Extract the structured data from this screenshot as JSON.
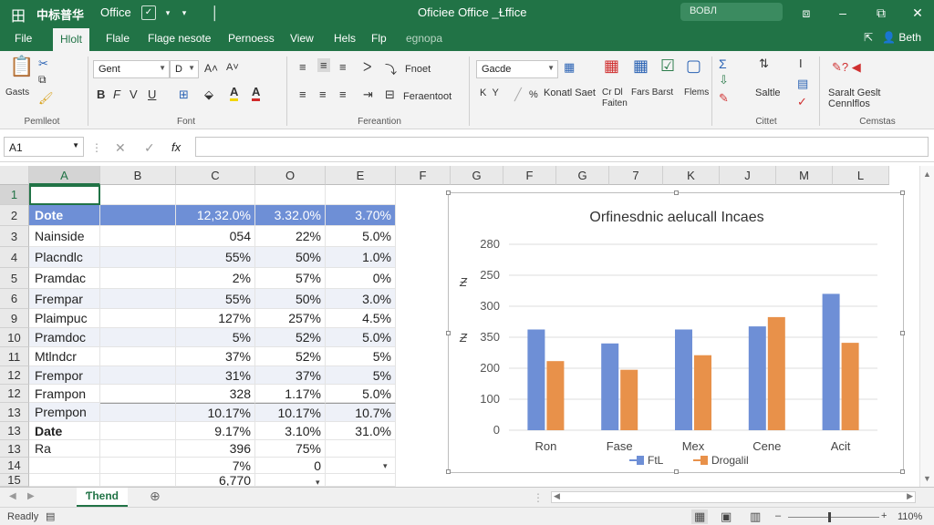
{
  "titlebar": {
    "app_glyph": "田",
    "app_name": "中标普华",
    "office_label": "Office",
    "doc_title": "Oficiee Office _Ɫffice",
    "search_text": "ВОВЛ"
  },
  "ribbon_tabs": [
    "File",
    "Hlolt",
    "Flale",
    "Flage nesote",
    "Pernoess",
    "View",
    "Hels",
    "Flp",
    "egnopa"
  ],
  "user_name": "Beth",
  "ribbon": {
    "clipboard": {
      "paste_label": "Gasts",
      "group_label": "Pemlleot"
    },
    "font": {
      "font_name": "Gent",
      "font_size": "D",
      "bold": "B",
      "italic": "F",
      "underline": "V",
      "U": "U",
      "group_label": "Font"
    },
    "alignment": {
      "wrap_label": "Fnoet",
      "merge_label": "Feraentoot",
      "group_label": "Fereantion"
    },
    "number": {
      "format": "Gacde",
      "styles_label": "Konatl Saet",
      "group_label": ""
    },
    "styles": {
      "cond_label": "Cr Dl",
      "cond_label2": "Faiten",
      "fmt_label": "Fars Barst",
      "cell_label": "Flems"
    },
    "cells": {
      "sort_label": "Saltle",
      "group_label": "Cittet"
    },
    "editing": {
      "label1": "Saralt Geslt",
      "label2": "Cennlflos",
      "group_label": "Cemstas"
    }
  },
  "formula_bar": {
    "name_box": "A1",
    "fx": "fx",
    "formula": ""
  },
  "columns": [
    "A",
    "B",
    "C",
    "O",
    "E",
    "F",
    "G",
    "F",
    "G",
    "7",
    "K",
    "J",
    "M",
    "L"
  ],
  "rows": [
    {
      "num": "1",
      "a": "",
      "c": "",
      "d": "",
      "e": ""
    },
    {
      "num": "2",
      "a": "Dote",
      "c": "12,32.0%",
      "d": "3.32.0%",
      "e": "3.70%"
    },
    {
      "num": "3",
      "a": "Nainside",
      "c": "054",
      "d": "22%",
      "e": "5.0%"
    },
    {
      "num": "4",
      "a": "Placndlc",
      "c": "55%",
      "d": "50%",
      "e": "1.0%"
    },
    {
      "num": "5",
      "a": "Pramdac",
      "c": "2%",
      "d": "57%",
      "e": "0%"
    },
    {
      "num": "6",
      "a": "Frempar",
      "c": "55%",
      "d": "50%",
      "e": "3.0%"
    },
    {
      "num": "9",
      "a": "Plaimpuc",
      "c": "127%",
      "d": "257%",
      "e": "4.5%"
    },
    {
      "num": "10",
      "a": "Pramdoc",
      "c": "5%",
      "d": "52%",
      "e": "5.0%"
    },
    {
      "num": "11",
      "a": "Mtlndcr",
      "c": "37%",
      "d": "52%",
      "e": "5%"
    },
    {
      "num": "12",
      "a": "Frempor",
      "c": "31%",
      "d": "37%",
      "e": "5%"
    },
    {
      "num": "12",
      "a": "Frampon",
      "c": "328",
      "d": "1.17%",
      "e": "5.0%"
    },
    {
      "num": "13",
      "a": "Prempon",
      "c": "10.17%",
      "d": "10.17%",
      "e": "10.7%"
    },
    {
      "num": "13",
      "a": "Date",
      "c": "9.17%",
      "d": "3.10%",
      "e": "31.0%"
    },
    {
      "num": "13",
      "a": "Ra",
      "c": "396",
      "d": "75%",
      "e": ""
    },
    {
      "num": "14",
      "a": "",
      "c": "7%",
      "d": "0",
      "e": ""
    },
    {
      "num": "15",
      "a": "",
      "c": "6,770",
      "d": "",
      "e": ""
    }
  ],
  "sheet_tab": "Ƭhend",
  "status": {
    "ready": "Readly",
    "zoom": "110%"
  },
  "chart_data": {
    "type": "bar",
    "title": "Orfinesdnic aelucall Incaes",
    "categories": [
      "Ron",
      "Fase",
      "Mex",
      "Cene",
      "Acit"
    ],
    "series": [
      {
        "name": "FtL",
        "color": "#6e8fd6",
        "values": [
          325,
          280,
          325,
          335,
          440
        ]
      },
      {
        "name": "Drogalil",
        "color": "#e8914a",
        "values": [
          223,
          195,
          242,
          365,
          282
        ]
      }
    ],
    "y_ticks": [
      "0",
      "100",
      "200",
      "350",
      "300",
      "250",
      "280"
    ],
    "y_tick_values": [
      0,
      100,
      200,
      300,
      400,
      500,
      600
    ],
    "ylim": [
      0,
      600
    ],
    "ylabel_glyph": "Ƶ",
    "grid": true,
    "legend": "bottom"
  }
}
